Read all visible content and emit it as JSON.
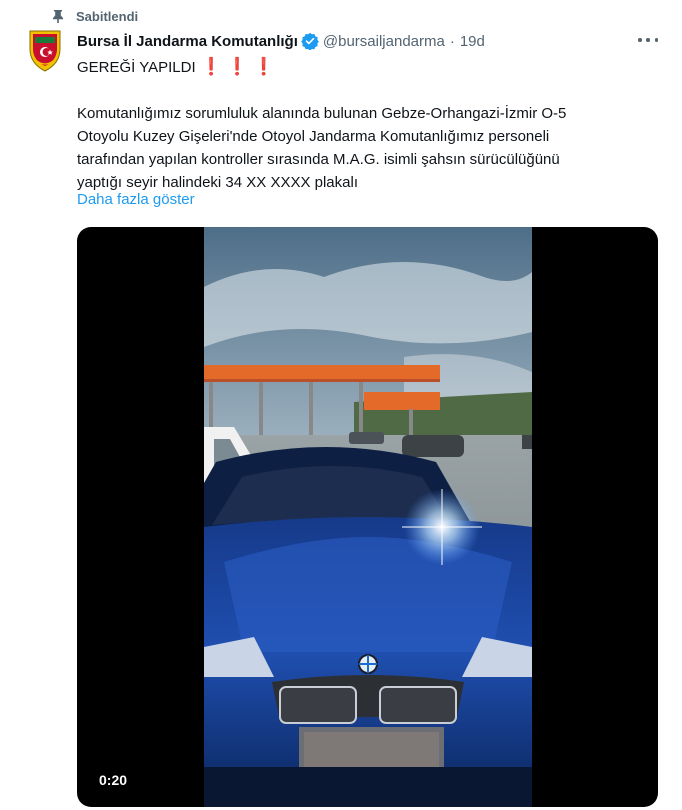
{
  "pinned": {
    "label": "Sabitlendi",
    "icon": "pin-icon"
  },
  "author": {
    "display_name": "Bursa İl Jandarma Komutanlığı",
    "verified_icon": "verified-badge-icon",
    "handle": "@bursailjandarma",
    "separator": "·",
    "time": "19d"
  },
  "tweet": {
    "headline": "GEREĞİ YAPILDI",
    "headline_marks": [
      "❗",
      "❗",
      "❗"
    ],
    "body_lines": [
      "Komutanlığımız sorumluluk alanında bulunan Gebze-Orhangazi-İzmir O-5",
      "Otoyolu Kuzey Gişeleri'nde Otoyol Jandarma Komutanlığımız personeli",
      "tarafından yapılan kontroller sırasında M.A.G. isimli şahsın sürücülüğünü",
      "yaptığı seyir halindeki 34 XX  XXXX plakalı"
    ],
    "show_more": "Daha fazla göster"
  },
  "media": {
    "type": "video",
    "duration": "0:20"
  },
  "colors": {
    "text": "#0f1419",
    "secondary": "#536471",
    "link": "#1d9bf0",
    "emoji_red": "#dd2e44"
  }
}
